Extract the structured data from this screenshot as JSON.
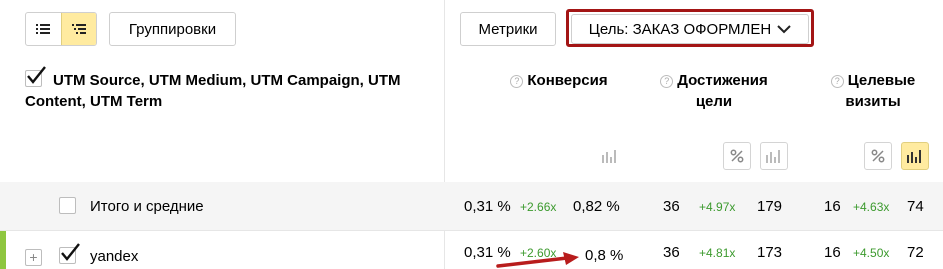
{
  "toolbar": {
    "groupings_label": "Группировки",
    "metrics_label": "Метрики",
    "goal_label": "Цель: ЗАКАЗ ОФОРМЛЕН"
  },
  "table": {
    "dimension_header": "UTM Source, UTM Medium, UTM Campaign, UTM Content, UTM Term",
    "columns": [
      {
        "label_line1": "Конверсия",
        "label_line2": ""
      },
      {
        "label_line1": "Достижения",
        "label_line2": "цели"
      },
      {
        "label_line1": "Целевые",
        "label_line2": "визиты"
      }
    ],
    "rows": [
      {
        "label": "Итого и средние",
        "conv_a": "0,31 %",
        "conv_delta": "+2.66x",
        "conv_b": "0,82 %",
        "goal_a": "36",
        "goal_delta": "+4.97x",
        "goal_b": "179",
        "visits_a": "16",
        "visits_delta": "+4.63x",
        "visits_b": "74"
      },
      {
        "label": "yandex",
        "conv_a": "0,31 %",
        "conv_delta": "+2.60x",
        "conv_b": "0,8 %",
        "goal_a": "36",
        "goal_delta": "+4.81x",
        "goal_b": "173",
        "visits_a": "16",
        "visits_delta": "+4.50x",
        "visits_b": "72"
      }
    ]
  },
  "icons": {
    "view_list": "list-icon",
    "view_tree": "tree-icon",
    "goal_dropdown": "chevron-down-icon",
    "percent": "percent-icon",
    "chart": "bar-chart-icon",
    "help": "help-icon",
    "expand": "plus-icon",
    "annotation": "red-arrow"
  },
  "colors": {
    "accent_yellow": "#ffeba0",
    "goal_outline": "#a31515",
    "delta_green": "#3c9a2e",
    "row_accent": "#8ec63f"
  }
}
